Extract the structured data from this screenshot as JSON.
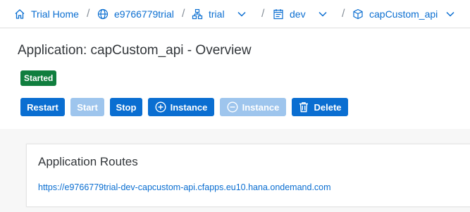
{
  "breadcrumbs": [
    {
      "label": "Trial Home",
      "icon": "home-icon"
    },
    {
      "label": "e9766779trial",
      "icon": "globe-icon"
    },
    {
      "label": "trial",
      "icon": "hierarchy-icon",
      "dropdown": true
    },
    {
      "label": "dev",
      "icon": "space-icon",
      "dropdown": true
    },
    {
      "label": "capCustom_api",
      "icon": "cube-icon",
      "dropdown": true
    }
  ],
  "separator": "/",
  "header": {
    "title": "Application: capCustom_api - Overview",
    "status": "Started"
  },
  "toolbar": {
    "restart": "Restart",
    "start": "Start",
    "stop": "Stop",
    "add_instance": "Instance",
    "remove_instance": "Instance",
    "delete": "Delete"
  },
  "routes": {
    "title": "Application Routes",
    "items": [
      "https://e9766779trial-dev-capcustom-api.cfapps.eu10.hana.ondemand.com"
    ]
  },
  "colors": {
    "accent": "#0a6ed1",
    "status_started": "#107e3e",
    "button_disabled": "#9ec5ed"
  }
}
